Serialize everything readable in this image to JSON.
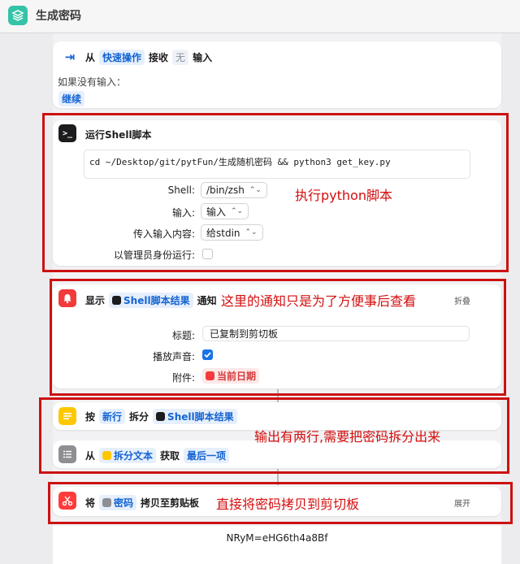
{
  "window": {
    "title": "生成密码",
    "app_icon": "layers-icon"
  },
  "input_card": {
    "prefix": "从",
    "source": "快速操作",
    "receive": "接收",
    "none_token": "无",
    "suffix": "输入",
    "if_no_input_label": "如果没有输入：",
    "continue_label": "继续"
  },
  "shell_card": {
    "title": "运行Shell脚本",
    "script": "cd ~/Desktop/git/pytFun/生成随机密码 && python3 get_key.py",
    "shell_label": "Shell:",
    "shell_value": "/bin/zsh",
    "input_label": "输入:",
    "input_value": "输入",
    "pass_label": "传入输入内容:",
    "pass_value": "给stdin",
    "admin_label": "以管理员身份运行:",
    "admin_checked": false
  },
  "notify_card": {
    "show": "显示",
    "token": "Shell脚本结果",
    "suffix": "通知",
    "collapse": "折叠",
    "title_label": "标题:",
    "title_value": "已复制到剪切板",
    "sound_label": "播放声音:",
    "sound_checked": true,
    "attach_label": "附件:",
    "attach_token": "当前日期"
  },
  "split_card": {
    "by": "按",
    "newline_token": "新行",
    "split": "拆分",
    "token": "Shell脚本结果"
  },
  "get_card": {
    "from": "从",
    "token": "拆分文本",
    "get": "获取",
    "item_token": "最后一项"
  },
  "copy_card": {
    "prefix": "将",
    "token": "密码",
    "suffix": "拷贝至剪贴板",
    "expand": "展开"
  },
  "output_text": "NRyM=eHG6th4a8Bf",
  "annotations": {
    "run_python": "执行python脚本",
    "notify_note": "这里的通知只是为了方便事后查看",
    "split_note": "输出有两行,需要把密码拆分出来",
    "copy_note": "直接将密码拷贝到剪切板"
  },
  "colors": {
    "accent_blue": "#1464d2",
    "annotation_red": "#d40d0d",
    "notify_red": "#f23b3b",
    "text_yellow": "#ffc700",
    "copy_red": "#ff3b3b",
    "list_gray": "#8e8e93",
    "terminal_black": "#1c1c1e"
  }
}
